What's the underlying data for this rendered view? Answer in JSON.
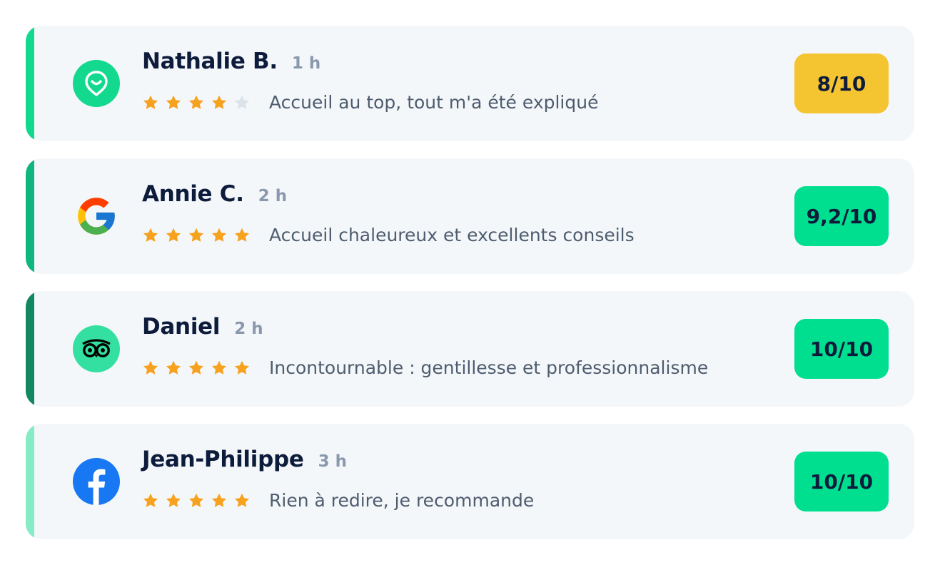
{
  "reviews": [
    {
      "name": "Nathalie B.",
      "time": "1 h",
      "rating": 4,
      "rating_max": 5,
      "comment": "Accueil au top, tout m'a été expliqué",
      "score": "8/10",
      "score_color": "#f5c431",
      "accent_color": "#13d98f",
      "source_icon": "map-pin-smile-icon"
    },
    {
      "name": "Annie C.",
      "time": "2 h",
      "rating": 5,
      "rating_max": 5,
      "comment": "Accueil chaleureux et excellents conseils",
      "score": "9,2/10",
      "score_color": "#00de8f",
      "accent_color": "#0fb67f",
      "source_icon": "google-icon"
    },
    {
      "name": "Daniel",
      "time": "2 h",
      "rating": 5,
      "rating_max": 5,
      "comment": "Incontournable : gentillesse et professionnalisme",
      "score": "10/10",
      "score_color": "#00de8f",
      "accent_color": "#118860",
      "source_icon": "tripadvisor-owl-icon"
    },
    {
      "name": "Jean-Philippe",
      "time": "3 h",
      "rating": 5,
      "rating_max": 5,
      "comment": "Rien à redire, je recommande",
      "score": "10/10",
      "score_color": "#00de8f",
      "accent_color": "#86ecc6",
      "source_icon": "facebook-icon"
    }
  ],
  "colors": {
    "card_bg": "#f4f7fa",
    "star_filled": "#f6a21e",
    "star_empty": "#dde3ea",
    "name_text": "#0e1c3c",
    "time_text": "#8998ac",
    "comment_text": "#4e5c6e"
  }
}
